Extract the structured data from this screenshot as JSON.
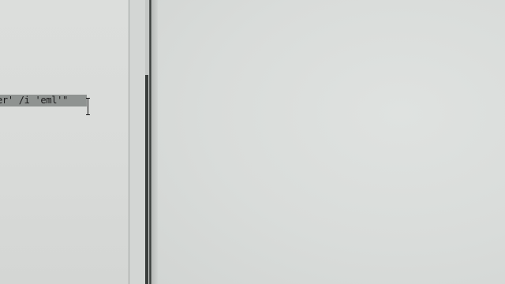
{
  "editor": {
    "visible_code_line": "er' /i 'eml'\"",
    "selection_active": true
  },
  "scrollbar": {
    "position_fraction": 0.74
  },
  "colors": {
    "background": "#d8dcd9",
    "selection": "#8f9391",
    "divider": "#2f3331",
    "text": "#1a1a1a"
  },
  "cursor": {
    "type": "i-beam"
  }
}
